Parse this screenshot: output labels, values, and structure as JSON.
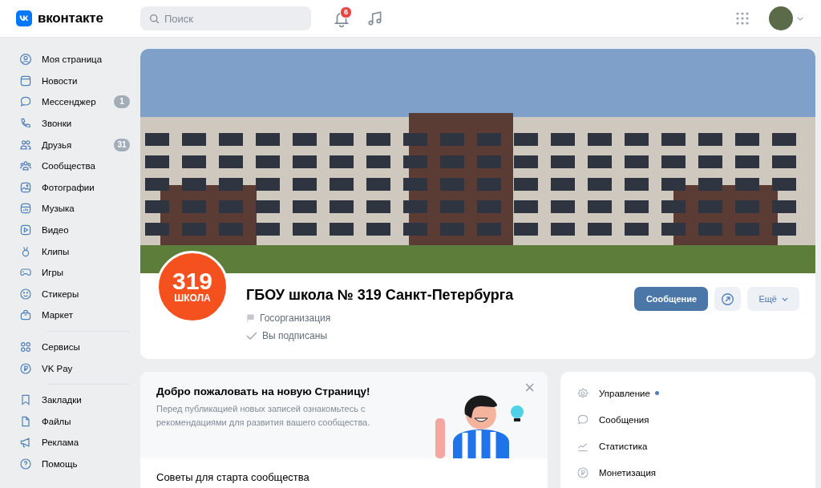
{
  "topbar": {
    "logo_text": "вконтакте",
    "search": {
      "placeholder": "Поиск"
    },
    "notifications_badge": "6"
  },
  "sidebar": {
    "groups": [
      [
        {
          "label": "Моя страница"
        },
        {
          "label": "Новости"
        },
        {
          "label": "Мессенджер",
          "badge": "1"
        },
        {
          "label": "Звонки"
        },
        {
          "label": "Друзья",
          "badge": "31"
        },
        {
          "label": "Сообщества"
        },
        {
          "label": "Фотографии"
        },
        {
          "label": "Музыка"
        },
        {
          "label": "Видео"
        },
        {
          "label": "Клипы"
        },
        {
          "label": "Игры"
        },
        {
          "label": "Стикеры"
        },
        {
          "label": "Маркет"
        }
      ],
      [
        {
          "label": "Сервисы"
        },
        {
          "label": "VK Pay"
        }
      ],
      [
        {
          "label": "Закладки"
        },
        {
          "label": "Файлы"
        },
        {
          "label": "Реклама"
        },
        {
          "label": "Помощь"
        }
      ]
    ]
  },
  "community": {
    "avatar_number": "319",
    "avatar_word": "ШКОЛА",
    "name": "ГБОУ школа № 319 Санкт-Петербурга",
    "category": "Госорганизация",
    "subscription": "Вы подписаны",
    "buttons": {
      "message": "Сообщение",
      "more": "Ещё"
    }
  },
  "welcome": {
    "title": "Добро пожаловать на новую Страницу!",
    "text": "Перед публикацией новых записей ознакомьтесь с рекомендациями для развития вашего сообщества.",
    "close": "×",
    "tips_title": "Советы для старта сообщества"
  },
  "manage_menu": [
    {
      "label": "Управление",
      "dot": true
    },
    {
      "label": "Сообщения",
      "dot": false
    },
    {
      "label": "Статистика",
      "dot": false
    },
    {
      "label": "Монетизация",
      "dot": false
    }
  ]
}
